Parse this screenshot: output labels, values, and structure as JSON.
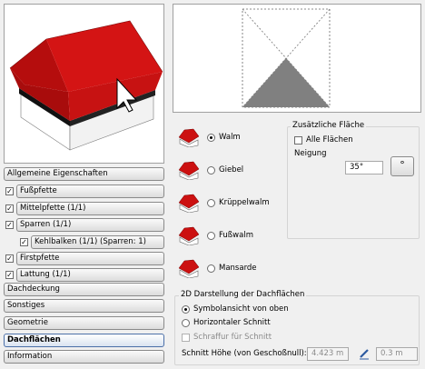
{
  "nav": {
    "allgemeine": "Allgemeine Eigenschaften",
    "dachdeckung": "Dachdeckung",
    "sonstiges": "Sonstiges",
    "geometrie": "Geometrie",
    "dachflaechen": "Dachflächen",
    "information": "Information"
  },
  "tree": [
    {
      "label": "Fußpfette",
      "checked": true
    },
    {
      "label": "Mittelpfette (1/1)",
      "checked": true
    },
    {
      "label": "Sparren (1/1)",
      "checked": true
    },
    {
      "label": "Kehlbalken (1/1) (Sparren: 1)",
      "checked": true
    },
    {
      "label": "Firstpfette",
      "checked": true
    },
    {
      "label": "Lattung (1/1)",
      "checked": true
    }
  ],
  "roof_types": [
    {
      "label": "Walm",
      "selected": true
    },
    {
      "label": "Giebel",
      "selected": false
    },
    {
      "label": "Krüppelwalm",
      "selected": false
    },
    {
      "label": "Fußwalm",
      "selected": false
    },
    {
      "label": "Mansarde",
      "selected": false
    }
  ],
  "zusaetzliche": {
    "title": "Zusätzliche Fläche",
    "alle_flaechen": "Alle Flächen",
    "neigung_label": "Neigung",
    "neigung_value": "35°",
    "degree_button": "°"
  },
  "darstellung": {
    "title": "2D Darstellung der Dachflächen",
    "symbol": "Symbolansicht von oben",
    "horizontal": "Horizontaler Schnitt",
    "schraffur": "Schraffur für Schnitt",
    "schnitt_label": "Schnitt Höhe (von Geschoßnull):",
    "schnitt_value": "4.423 m",
    "schnitt_value2": "0.3 m"
  },
  "colors": {
    "roof": "#cc1111",
    "accent": "#4b6fa8"
  }
}
